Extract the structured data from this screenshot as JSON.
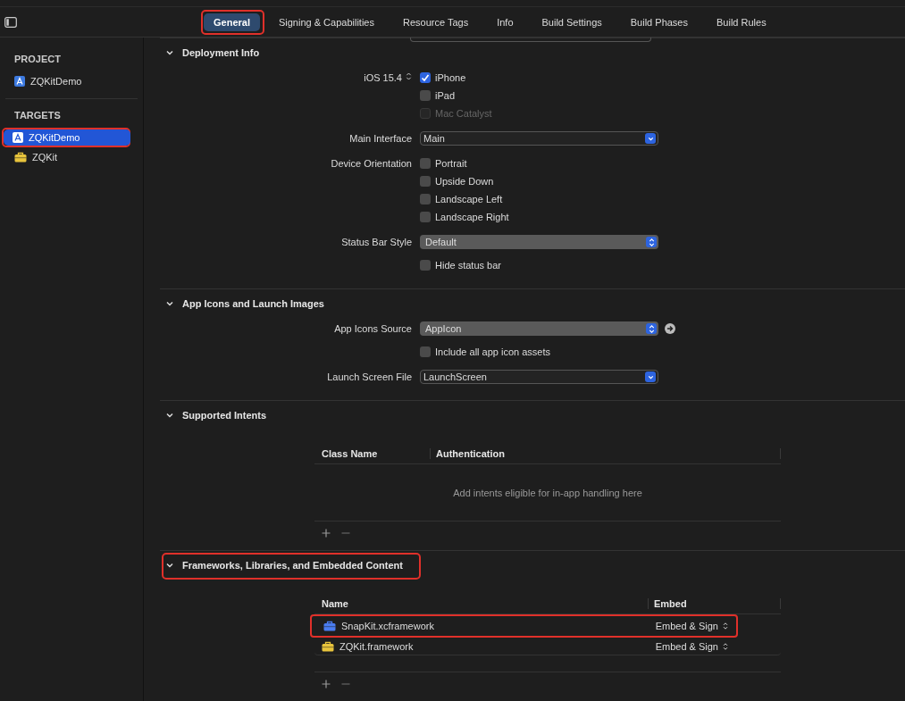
{
  "tabs": [
    {
      "label": "General",
      "selected": true,
      "highlighted": true
    },
    {
      "label": "Signing & Capabilities",
      "selected": false,
      "highlighted": false
    },
    {
      "label": "Resource Tags",
      "selected": false,
      "highlighted": false
    },
    {
      "label": "Info",
      "selected": false,
      "highlighted": false
    },
    {
      "label": "Build Settings",
      "selected": false,
      "highlighted": false
    },
    {
      "label": "Build Phases",
      "selected": false,
      "highlighted": false
    },
    {
      "label": "Build Rules",
      "selected": false,
      "highlighted": false
    }
  ],
  "sidebar": {
    "groups": [
      {
        "title": "PROJECT",
        "items": [
          {
            "label": "ZQKitDemo",
            "kind": "app",
            "selected": false,
            "highlighted": false
          }
        ]
      },
      {
        "title": "TARGETS",
        "items": [
          {
            "label": "ZQKitDemo",
            "kind": "app",
            "selected": true,
            "highlighted": true
          },
          {
            "label": "ZQKit",
            "kind": "toolbox",
            "selected": false,
            "highlighted": false
          }
        ]
      }
    ]
  },
  "sections": [
    {
      "kind": "form",
      "title": "Deployment Info",
      "expanded": true,
      "highlighted": false,
      "rows": [
        {
          "label": "iOS 15.4",
          "stepper": true,
          "controls": [
            {
              "kind": "checkbox",
              "text": "iPhone",
              "checked": true,
              "disabled": false
            },
            {
              "kind": "checkbox",
              "text": "iPad",
              "checked": false,
              "disabled": false
            },
            {
              "kind": "checkbox",
              "text": "Mac Catalyst",
              "checked": false,
              "disabled": true
            }
          ]
        },
        {
          "label": "Main Interface",
          "stepper": false,
          "controls": [
            {
              "kind": "combo",
              "value": "Main"
            }
          ]
        },
        {
          "label": "Device Orientation",
          "stepper": false,
          "controls": [
            {
              "kind": "checkbox",
              "text": "Portrait",
              "checked": false,
              "disabled": false
            },
            {
              "kind": "checkbox",
              "text": "Upside Down",
              "checked": false,
              "disabled": false
            },
            {
              "kind": "checkbox",
              "text": "Landscape Left",
              "checked": false,
              "disabled": false
            },
            {
              "kind": "checkbox",
              "text": "Landscape Right",
              "checked": false,
              "disabled": false
            }
          ]
        },
        {
          "label": "Status Bar Style",
          "stepper": false,
          "controls": [
            {
              "kind": "popup",
              "value": "Default",
              "go": false
            },
            {
              "kind": "checkbox",
              "text": "Hide status bar",
              "checked": false,
              "disabled": false
            }
          ]
        }
      ]
    },
    {
      "kind": "form",
      "title": "App Icons and Launch Images",
      "expanded": true,
      "highlighted": false,
      "rows": [
        {
          "label": "App Icons Source",
          "stepper": false,
          "controls": [
            {
              "kind": "popup",
              "value": "AppIcon",
              "go": true
            },
            {
              "kind": "checkbox",
              "text": "Include all app icon assets",
              "checked": false,
              "disabled": false
            }
          ]
        },
        {
          "label": "Launch Screen File",
          "stepper": false,
          "controls": [
            {
              "kind": "combo",
              "value": "LaunchScreen"
            }
          ]
        }
      ]
    },
    {
      "kind": "table",
      "title": "Supported Intents",
      "expanded": true,
      "highlighted": false,
      "columns": [
        "Class Name",
        "Authentication"
      ],
      "empty_text": "Add intents eligible for in-app handling here"
    },
    {
      "kind": "table",
      "title": "Frameworks, Libraries, and Embedded Content",
      "expanded": true,
      "highlighted": true,
      "columns": [
        "Name",
        "Embed"
      ],
      "rows": [
        {
          "name": "SnapKit.xcframework",
          "color": "#4a7cf0",
          "embed": "Embed & Sign",
          "highlighted": true
        },
        {
          "name": "ZQKit.framework",
          "color": "#e8c43c",
          "embed": "Embed & Sign",
          "highlighted": false
        }
      ]
    }
  ]
}
